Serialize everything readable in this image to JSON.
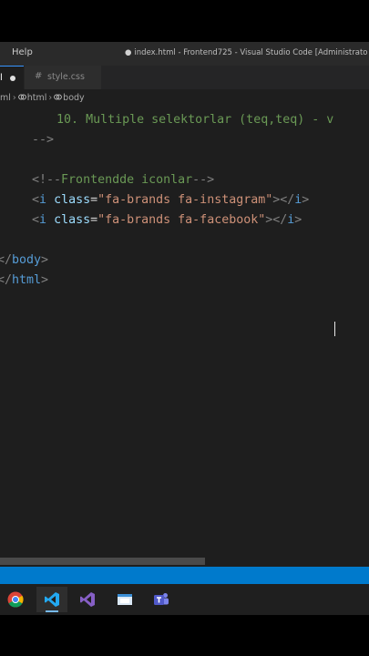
{
  "titlebar": {
    "menu_help": "Help",
    "window_title": "index.html - Frontend725 - Visual Studio Code [Administrato"
  },
  "tabs": {
    "active_fragment": "l",
    "style_tab": "style.css",
    "style_icon": "#"
  },
  "breadcrumb": {
    "first": "ml",
    "html": "html",
    "body": "body"
  },
  "editor": {
    "lines": [
      {
        "indent": "      ",
        "text": "10. Multiple selektorlar (teq,teq) - v"
      },
      {
        "indent": "  ",
        "text": "-->"
      },
      {
        "indent": "  ",
        "comment_open": "<!--",
        "comment_text": "Frontendde iconlar",
        "comment_close": "-->"
      },
      {
        "indent": "  ",
        "tag": "i",
        "attr": "class",
        "value": "\"fa-brands fa-instagram\"",
        "close_tag": "i"
      },
      {
        "indent": "  ",
        "tag": "i",
        "attr": "class",
        "value": "\"fa-brands fa-facebook\"",
        "close_tag": "i"
      },
      {
        "indent": "",
        "end_tag": "body"
      },
      {
        "indent": "",
        "end_tag": "html"
      }
    ]
  },
  "taskbar": {
    "apps": [
      "chrome-icon",
      "vscode-icon",
      "visual-studio-icon",
      "window-icon",
      "teams-icon"
    ]
  },
  "colors": {
    "statusbar": "#007acc",
    "comment": "#6a9955",
    "tag": "#569cd6",
    "attr": "#9cdcfe",
    "string": "#ce9178"
  }
}
